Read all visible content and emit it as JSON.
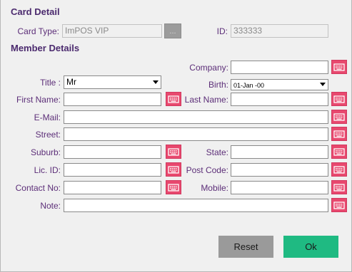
{
  "sections": {
    "card_detail": "Card Detail",
    "member_details": "Member Details"
  },
  "card": {
    "type_label": "Card Type:",
    "type_value": "ImPOS VIP",
    "picker_label": "...",
    "id_label": "ID:",
    "id_value": "333333"
  },
  "member": {
    "company_label": "Company:",
    "company_value": "",
    "title_label": "Title :",
    "title_value": "Mr",
    "birth_label": "Birth:",
    "birth_value": "01-Jan -00",
    "first_name_label": "First Name:",
    "first_name_value": "",
    "last_name_label": "Last Name:",
    "last_name_value": "",
    "email_label": "E-Mail:",
    "email_value": "",
    "street_label": "Street:",
    "street_value": "",
    "suburb_label": "Suburb:",
    "suburb_value": "",
    "state_label": "State:",
    "state_value": "",
    "lic_id_label": "Lic. ID:",
    "lic_id_value": "",
    "post_code_label": "Post Code:",
    "post_code_value": "",
    "contact_no_label": "Contact No:",
    "contact_no_value": "",
    "mobile_label": "Mobile:",
    "mobile_value": "",
    "note_label": "Note:",
    "note_value": ""
  },
  "buttons": {
    "reset": "Reset",
    "ok": "Ok"
  },
  "colors": {
    "label": "#5c2e78",
    "keyboard_button": "#e8486e",
    "ok_button": "#1fba82",
    "reset_button": "#9a9a9a"
  },
  "icons": {
    "keyboard": "keyboard-icon",
    "dropdown": "chevron-down-icon"
  }
}
